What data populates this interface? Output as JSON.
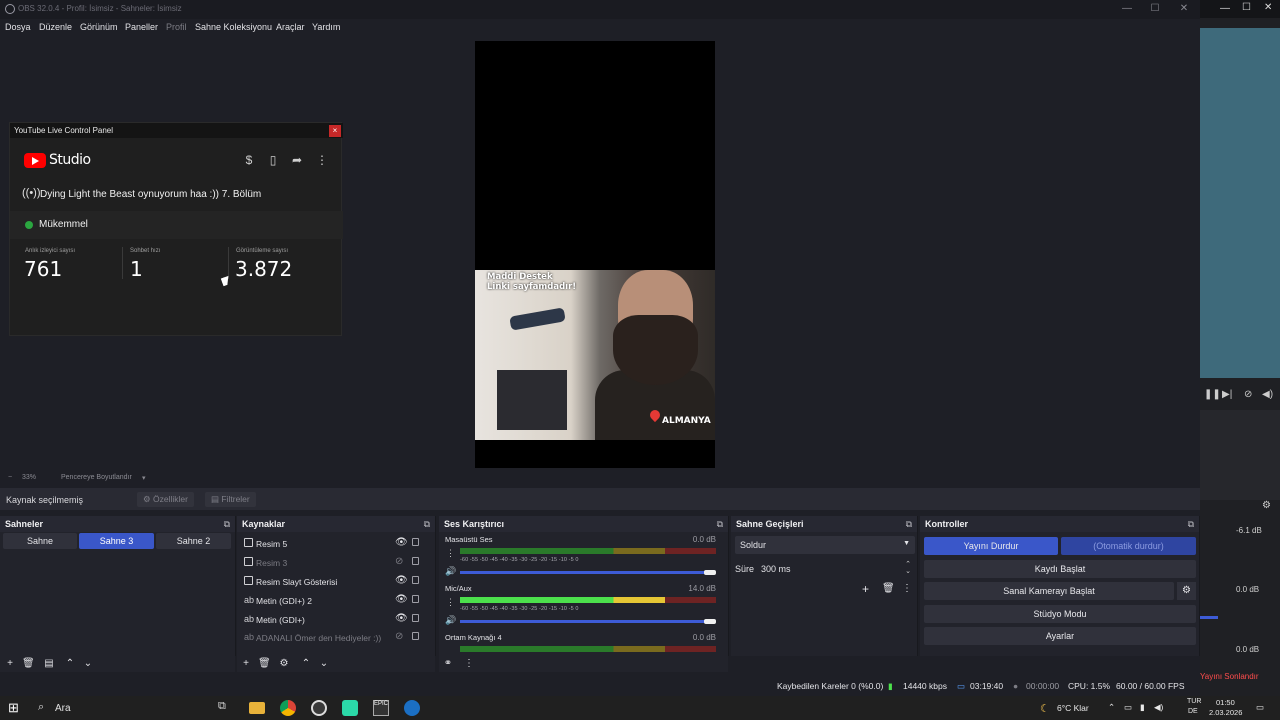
{
  "window": {
    "title": "OBS 32.0.4 - Profil: İsimsiz - Sahneler: İsimsiz",
    "min": "—",
    "max": "☐",
    "close": "✕"
  },
  "menu": [
    "Dosya",
    "Düzenle",
    "Görünüm",
    "Paneller",
    "Profil",
    "Sahne Koleksiyonu",
    "Araçlar",
    "Yardım"
  ],
  "camera_overlay": {
    "line1": "Maddi Destek",
    "line2": "Linki sayfamdadır!",
    "location": "ALMANYA"
  },
  "yt_panel": {
    "header": "YouTube Live Control Panel",
    "close": "×",
    "brand": "Studio",
    "stream_title": "Dying Light the Beast oynuyorum haa :)) 7. Bölüm",
    "status": "Mükemmel",
    "stats": [
      {
        "label": "Anlık izleyici sayısı",
        "value": "761"
      },
      {
        "label": "Sohbet hızı",
        "value": "1"
      },
      {
        "label": "Görüntüleme sayısı",
        "value": "3.872"
      }
    ]
  },
  "zoombar": {
    "minus": "−",
    "zoom": "33%",
    "fit": "Pencereye Boyutlandır",
    "chev": "▾"
  },
  "context": {
    "no_source": "Kaynak seçilmemiş",
    "properties": "Özellikler",
    "filters": "Filtreler"
  },
  "docks": {
    "scenes": {
      "title": "Sahneler",
      "items": [
        "Sahne",
        "Sahne 3",
        "Sahne 2"
      ],
      "active": "Sahne 3"
    },
    "sources": {
      "title": "Kaynaklar",
      "items": [
        {
          "label": "Resim 5",
          "visible": true
        },
        {
          "label": "Resim 3",
          "visible": false
        },
        {
          "label": "Resim Slayt Gösterisi",
          "visible": true
        },
        {
          "label": "Metin (GDI+) 2",
          "visible": true
        },
        {
          "label": "Metin (GDI+)",
          "visible": true
        },
        {
          "label": "ADANALI Ömer den Hediyeler :))",
          "visible": false
        }
      ]
    },
    "mixer": {
      "title": "Ses Karıştırıcı",
      "ticks": "-60   -55   -50   -45   -40   -35   -30   -25   -20   -15   -10    -5    0",
      "channels": [
        {
          "name": "Masaüstü Ses",
          "db": "0.0 dB",
          "level_pct": 0
        },
        {
          "name": "Mic/Aux",
          "db": "14.0 dB",
          "level_pct": 80
        },
        {
          "name": "Ortam Kaynağı 4",
          "db": "0.0 dB",
          "level_pct": 0
        }
      ]
    },
    "transitions": {
      "title": "Sahne Geçişleri",
      "selected": "Soldur",
      "duration_label": "Süre",
      "duration": "300 ms"
    },
    "controls": {
      "title": "Kontroller",
      "stop_stream": "Yayını Durdur",
      "auto_stop": "(Otomatik durdur)",
      "start_record": "Kaydı Başlat",
      "virtual_cam": "Sanal Kamerayı Başlat",
      "studio_mode": "Stüdyo Modu",
      "settings": "Ayarlar"
    }
  },
  "statusbar": {
    "dropped": "Kaybedilen Kareler 0 (%0.0)",
    "bitrate": "14440 kbps",
    "stream_time": "03:19:40",
    "rec_time": "00:00:00",
    "cpu": "CPU: 1.5%",
    "fps": "60.00 / 60.00 FPS"
  },
  "right_panel": {
    "db1": "-6.1 dB",
    "db2": "0.0 dB",
    "db3": "0.0 dB",
    "end_stream": "Yayını Sonlandır"
  },
  "taskbar": {
    "search": "Ara",
    "weather": "6°C  Klar",
    "lang1": "TUR",
    "lang2": "DE",
    "time": "01:50",
    "date": "2.03.2026"
  },
  "colors": {
    "accent": "#3a57c9",
    "record_red": "#c62828",
    "live_green": "#2ba640"
  }
}
